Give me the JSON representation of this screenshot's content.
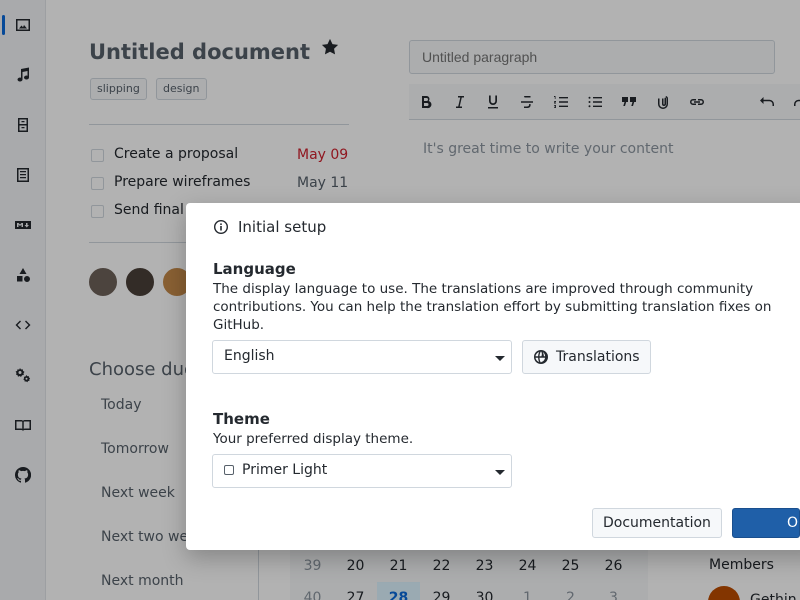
{
  "document": {
    "title": "Untitled document",
    "tags": [
      "slipping",
      "design"
    ],
    "tasks": [
      {
        "label": "Create a proposal",
        "date": "May 09",
        "date_color": "#cf222e"
      },
      {
        "label": "Prepare wireframes",
        "date": "May 11",
        "date_color": "#57606a"
      },
      {
        "label": "Send final",
        "date": "",
        "date_color": "#57606a"
      }
    ],
    "due": {
      "title": "Choose due",
      "options": [
        "Today",
        "Tomorrow",
        "Next week",
        "Next two we",
        "Next month"
      ]
    }
  },
  "editor": {
    "paragraph_placeholder": "Untitled paragraph",
    "content_placeholder": "It's great time to write your content"
  },
  "calendar": {
    "row1": [
      "39",
      "20",
      "21",
      "22",
      "23",
      "24",
      "25",
      "26"
    ],
    "row2": [
      "40",
      "27",
      "28",
      "29",
      "30",
      "1",
      "2",
      "3"
    ],
    "selected_day": "28"
  },
  "members": {
    "label": "Members",
    "first_name": "Gethin"
  },
  "dialog": {
    "title": "Initial setup",
    "language": {
      "title": "Language",
      "description": "The display language to use. The translations are improved through community contributions. You can help the translation effort by submitting translation fixes on GitHub.",
      "selected": "English",
      "translations_button": "Translations"
    },
    "theme": {
      "title": "Theme",
      "description": "Your preferred display theme.",
      "selected": "Primer Light"
    },
    "documentation_button": "Documentation",
    "ok_button": "OK"
  },
  "colors": {
    "accent": "#0969da",
    "primary_button": "#1f5fa8",
    "overdue": "#cf222e"
  }
}
